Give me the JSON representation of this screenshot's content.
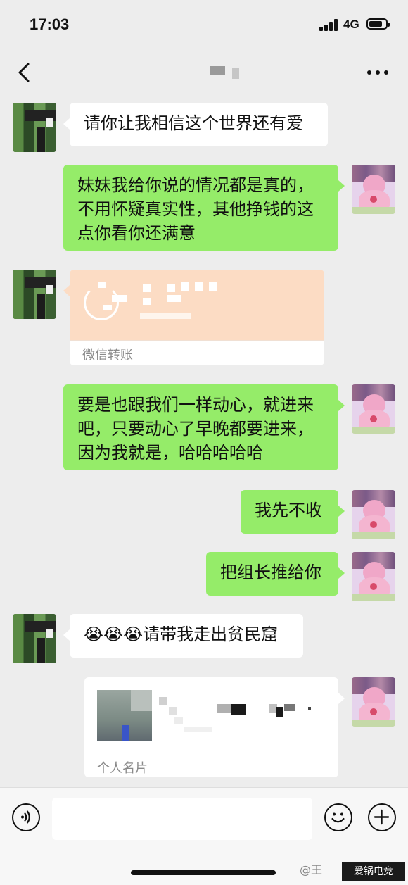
{
  "status_bar": {
    "time": "17:03",
    "network": "4G",
    "battery_level": 0.85
  },
  "nav": {
    "title": ""
  },
  "messages": [
    {
      "side": "left",
      "type": "text",
      "text": "请你让我相信这个世界还有爱"
    },
    {
      "side": "right",
      "type": "text",
      "lines": [
        "妹妹我给你说的情况都是真的，",
        "不用怀疑真实性，其他挣钱的这",
        "点你看你还满意"
      ]
    },
    {
      "side": "left",
      "type": "transfer",
      "label": "微信转账"
    },
    {
      "side": "right",
      "type": "text",
      "lines": [
        "要是也跟我们一样动心，就进来",
        "吧，只要动心了早晚都要进来，",
        "因为我就是，哈哈哈哈哈"
      ]
    },
    {
      "side": "right",
      "type": "text",
      "text": "我先不收"
    },
    {
      "side": "right",
      "type": "text",
      "text": "把组长推给你"
    },
    {
      "side": "left",
      "type": "text",
      "emoji": "😭😭😭",
      "text": "请带我走出贫民窟"
    },
    {
      "side": "right",
      "type": "contact_card",
      "label": "个人名片"
    }
  ],
  "watermark": {
    "left": "@王",
    "box": "爱锅电竞"
  },
  "colors": {
    "background": "#ededed",
    "bubble_me": "#95ec69",
    "bubble_other": "#ffffff",
    "transfer": "#fcdcc4"
  },
  "icons": [
    "back-icon",
    "more-icon",
    "voice-icon",
    "emoji-icon",
    "add-icon"
  ]
}
